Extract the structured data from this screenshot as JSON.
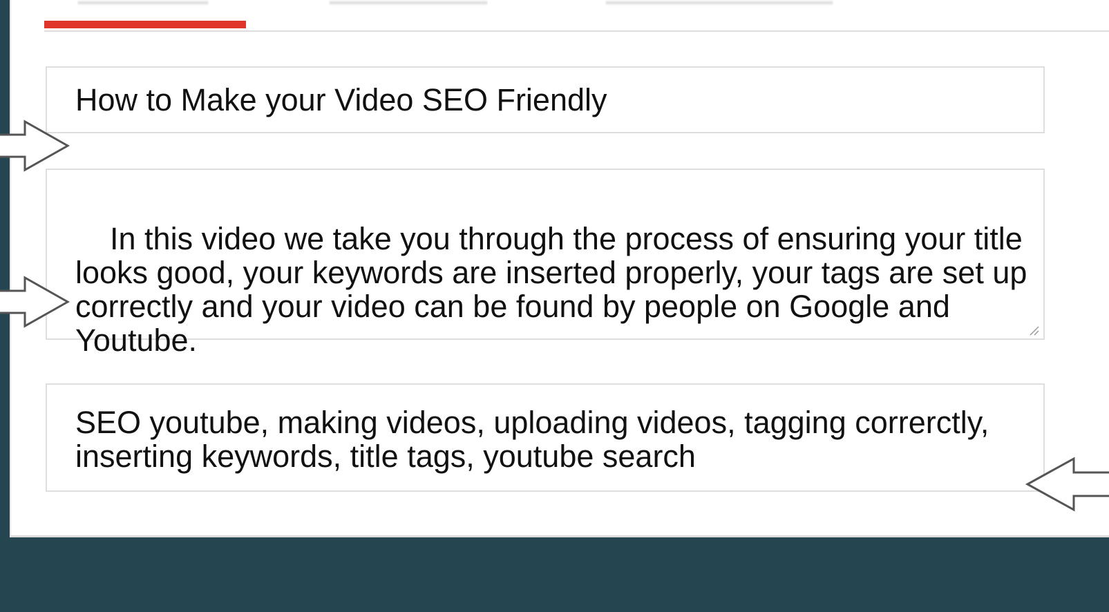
{
  "tabs": [
    {
      "label": ""
    },
    {
      "label": ""
    },
    {
      "label": ""
    }
  ],
  "active_tab_index": 0,
  "accent_color": "#e0352b",
  "background_color": "#254650",
  "form": {
    "title": "How to Make your Video SEO Friendly",
    "description": "In this video we take you through the process of ensuring your title looks good, your keywords are inserted properly, your tags are set up correctly and your video can be found by people on Google and Youtube.",
    "tags": "SEO youtube, making videos, uploading videos, tagging correrctly, inserting keywords, title tags, youtube search"
  },
  "annotations": [
    {
      "icon": "arrow-right-icon",
      "points_to": "title-field"
    },
    {
      "icon": "arrow-right-icon",
      "points_to": "description-field"
    },
    {
      "icon": "arrow-left-icon",
      "points_to": "tags-field"
    }
  ]
}
